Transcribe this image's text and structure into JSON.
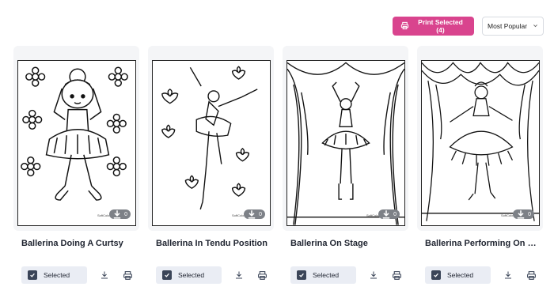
{
  "toolbar": {
    "print_label": "Print Selected (4)",
    "print_icon": "printer-icon",
    "sort_value": "Most Popular",
    "sort_icon": "chevron-down-icon",
    "accent_color": "#d9448e"
  },
  "cards": [
    {
      "title": "Ballerina Doing A Curtsy",
      "selected_label": "Selected",
      "download_count": "0",
      "brand": "SoftColoring"
    },
    {
      "title": "Ballerina In Tendu Position",
      "selected_label": "Selected",
      "download_count": "0",
      "brand": "SoftColoring"
    },
    {
      "title": "Ballerina On Stage",
      "selected_label": "Selected",
      "download_count": "0",
      "brand": "SoftColoring"
    },
    {
      "title": "Ballerina Performing On Stage",
      "selected_label": "Selected",
      "download_count": "0",
      "brand": "SoftColoring"
    }
  ]
}
